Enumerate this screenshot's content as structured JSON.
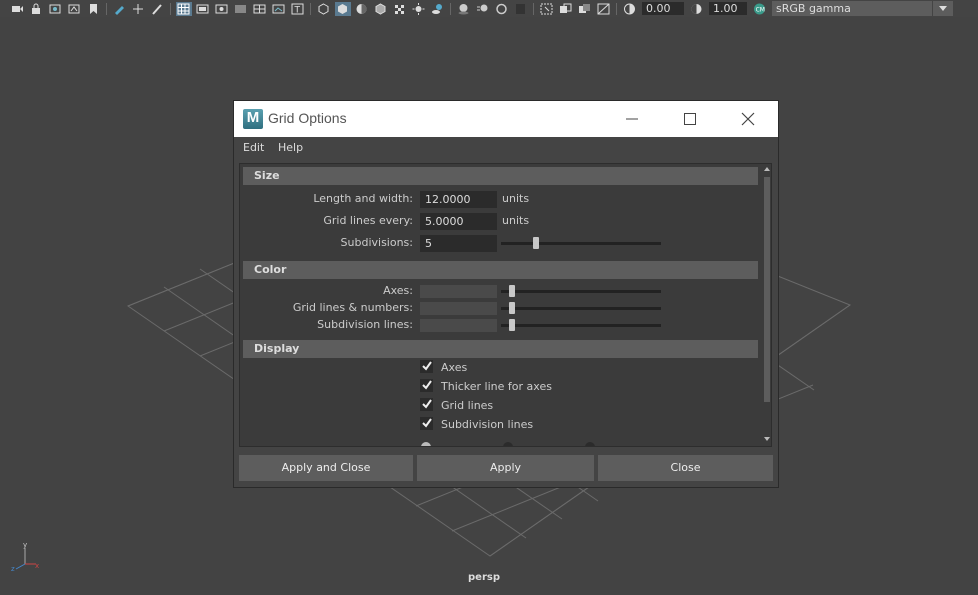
{
  "toolbar": {
    "exposure_value": "0.00",
    "gamma_value": "1.00",
    "colorspace_value": "sRGB gamma",
    "icons": [
      "camera-icon",
      "bookmark-icon",
      "image-plane-icon",
      "camera-attr-icon",
      "grid-icon",
      "film-gate-icon",
      "resolution-gate-icon",
      "gate-mask-icon",
      "field-chart-icon",
      "safe-action-icon",
      "safe-title-icon",
      "wireframe-icon",
      "smooth-shade-icon",
      "default-material-icon",
      "textured-icon",
      "lights-icon",
      "shadows-icon",
      "screen-ao-icon",
      "motion-blur-icon",
      "multisample-icon",
      "dof-icon",
      "isolate-icon",
      "xray-icon",
      "xray-joints-icon",
      "xray-active-icon",
      "exposure-icon",
      "gamma-icon",
      "color-mgmt-icon"
    ]
  },
  "viewport": {
    "camera_label": "persp",
    "axis_y": "y",
    "axis_x": "x",
    "axis_z": "z"
  },
  "dialog": {
    "title": "Grid Options",
    "menu": [
      "Edit",
      "Help"
    ],
    "sections": {
      "size": {
        "header": "Size",
        "length_label": "Length and width:",
        "length_value": "12.0000",
        "length_unit": "units",
        "every_label": "Grid lines every:",
        "every_value": "5.0000",
        "every_unit": "units",
        "subdiv_label": "Subdivisions:",
        "subdiv_value": "5",
        "subdiv_slider": 0.22
      },
      "color": {
        "header": "Color",
        "axes_label": "Axes:",
        "axes_slider": 0.07,
        "gridlines_label": "Grid lines & numbers:",
        "gridlines_slider": 0.07,
        "subdivlines_label": "Subdivision lines:",
        "subdivlines_slider": 0.07
      },
      "display": {
        "header": "Display",
        "checkboxes": [
          {
            "label": "Axes",
            "checked": true
          },
          {
            "label": "Thicker line for axes",
            "checked": true
          },
          {
            "label": "Grid lines",
            "checked": true
          },
          {
            "label": "Subdivision lines",
            "checked": true
          }
        ]
      }
    },
    "buttons": {
      "apply_close": "Apply and Close",
      "apply": "Apply",
      "close": "Close"
    }
  }
}
